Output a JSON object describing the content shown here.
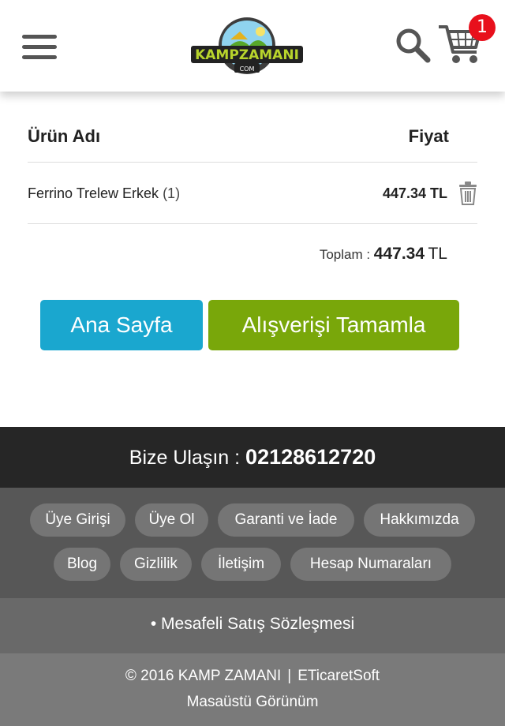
{
  "header": {
    "logo_text": "KAMPZAMANI",
    "logo_sub": "COM",
    "cart_count": "1",
    "icons": {
      "menu": "hamburger-icon",
      "search": "search-icon",
      "cart": "cart-icon"
    },
    "badge_color": "#e8101c"
  },
  "cart": {
    "col_name": "Ürün Adı",
    "col_price": "Fiyat",
    "items": [
      {
        "name": "Ferrino Trelew Erkek",
        "qty": "(1)",
        "price": "447.34 TL"
      }
    ],
    "total_label": "Toplam : ",
    "total_value": "447.34",
    "total_currency": "TL"
  },
  "actions": {
    "home_label": "Ana Sayfa",
    "checkout_label": "Alışverişi Tamamla",
    "home_color": "#1aa7cf",
    "checkout_color": "#79a70a"
  },
  "footer": {
    "contact_label": "Bize Ulaşın : ",
    "contact_phone": "02128612720",
    "links": [
      "Üye Girişi",
      "Üye Ol",
      "Garanti ve İade",
      "Hakkımızda",
      "Blog",
      "Gizlilik",
      "İletişim",
      "Hesap Numaraları"
    ],
    "contract_label": "• Mesafeli Satış Sözleşmesi",
    "copyright": "© 2016 KAMP ZAMANI",
    "separator": "|",
    "vendor": "ETicaretSoft",
    "desktop_view": "Masaüstü Görünüm"
  }
}
